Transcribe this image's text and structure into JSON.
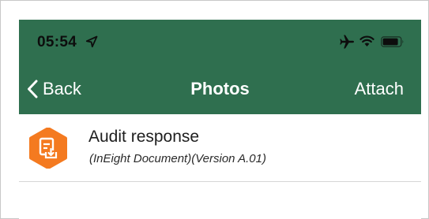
{
  "status_bar": {
    "time": "05:54",
    "icons": [
      "location-arrow-icon",
      "airplane-icon",
      "wifi-icon",
      "battery-icon"
    ]
  },
  "nav": {
    "back_label": "Back",
    "title": "Photos",
    "attach_label": "Attach"
  },
  "items": [
    {
      "title": "Audit response",
      "subtitle": "(InEight Document)(Version  A.01)",
      "icon": "document-download-icon"
    }
  ],
  "colors": {
    "header_bg": "#2f6f4f",
    "icon_badge": "#f47a20",
    "text_primary": "#1e1e1e"
  }
}
